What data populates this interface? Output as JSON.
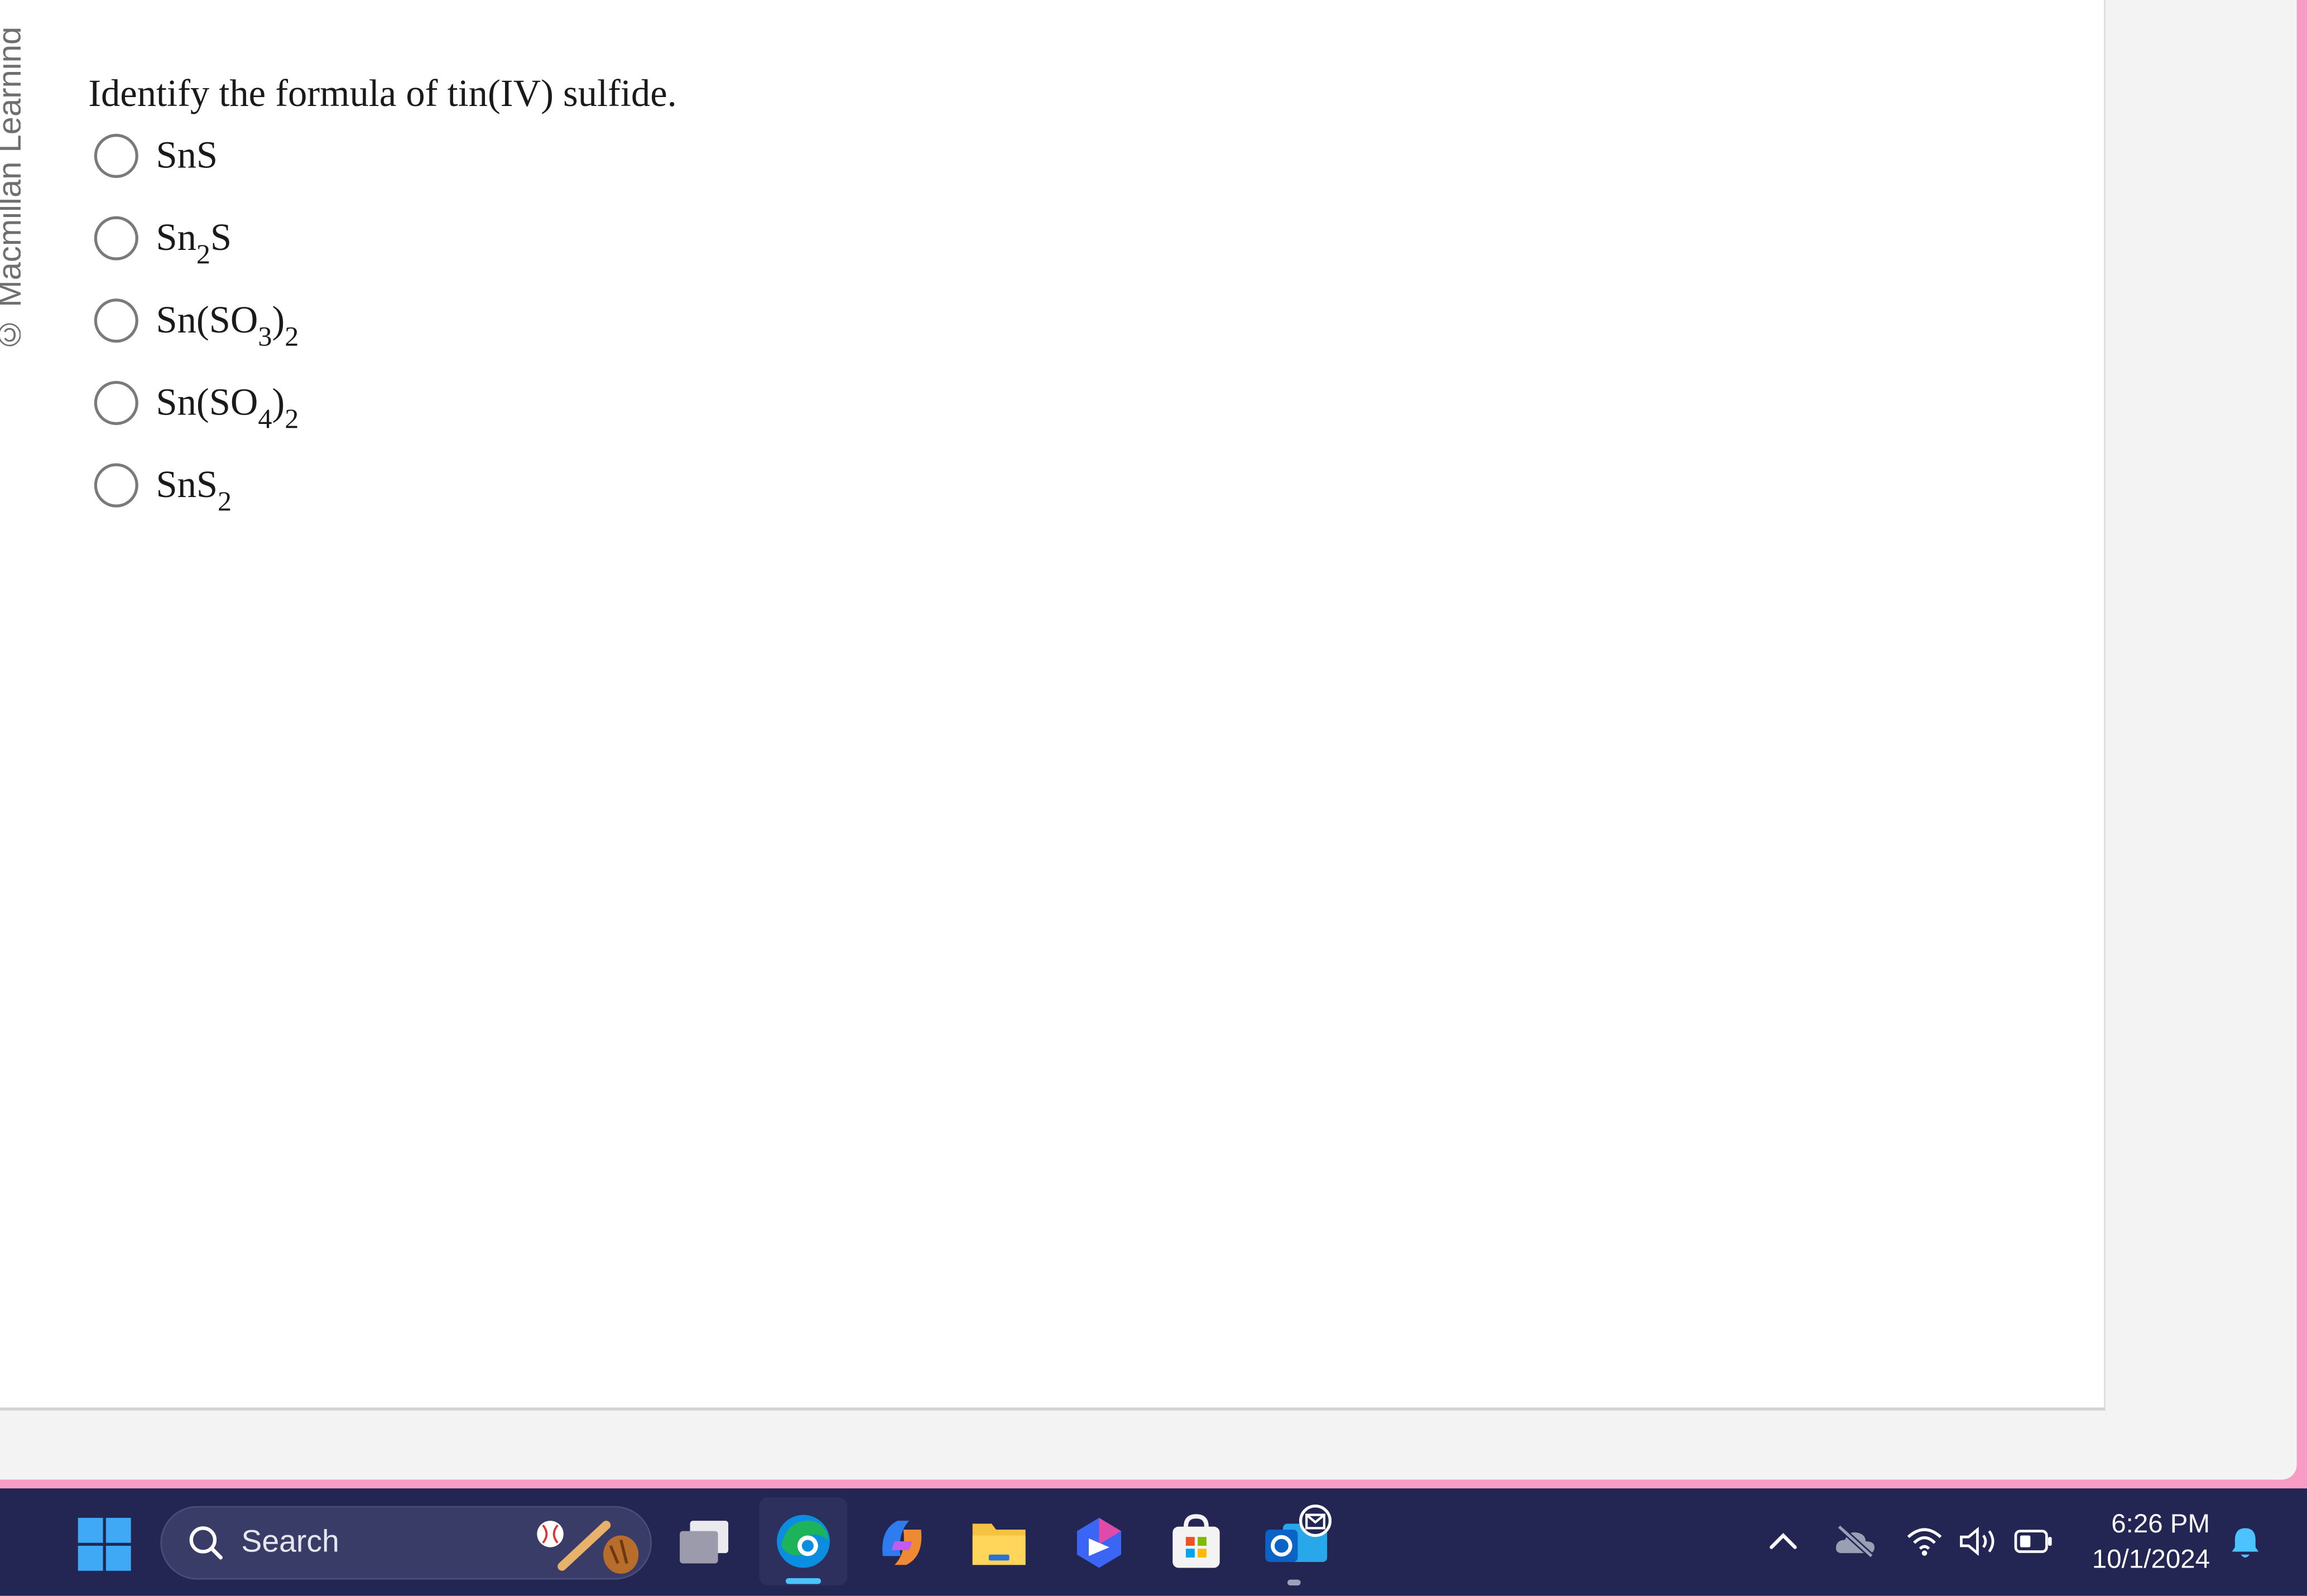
{
  "watermark": "© Macmillan Learning",
  "question": {
    "text": "Identify the formula of tin(IV) sulfide."
  },
  "options": [
    {
      "parts": [
        {
          "t": "SnS"
        }
      ]
    },
    {
      "parts": [
        {
          "t": "Sn"
        },
        {
          "sub": "2"
        },
        {
          "t": "S"
        }
      ]
    },
    {
      "parts": [
        {
          "t": "Sn(SO"
        },
        {
          "sub": "3"
        },
        {
          "t": ")"
        },
        {
          "sub": "2"
        }
      ]
    },
    {
      "parts": [
        {
          "t": "Sn(SO"
        },
        {
          "sub": "4"
        },
        {
          "t": ")"
        },
        {
          "sub": "2"
        }
      ]
    },
    {
      "parts": [
        {
          "t": "SnS"
        },
        {
          "sub": "2"
        }
      ]
    }
  ],
  "taskbar": {
    "search_label": "Search",
    "time": "6:26 PM",
    "date": "10/1/2024",
    "icons": [
      "windows-start-icon",
      "search-icon",
      "baseball-widget-icon",
      "task-view-icon",
      "edge-icon",
      "copilot-icon",
      "file-explorer-icon",
      "bing-icon",
      "microsoft-store-icon",
      "outlook-icon"
    ],
    "tray_icons": [
      "chevron-up-icon",
      "onedrive-icon",
      "wifi-icon",
      "volume-icon",
      "battery-icon",
      "notification-bell-icon"
    ],
    "accent": "#4cc2ff",
    "background": "#232552"
  }
}
